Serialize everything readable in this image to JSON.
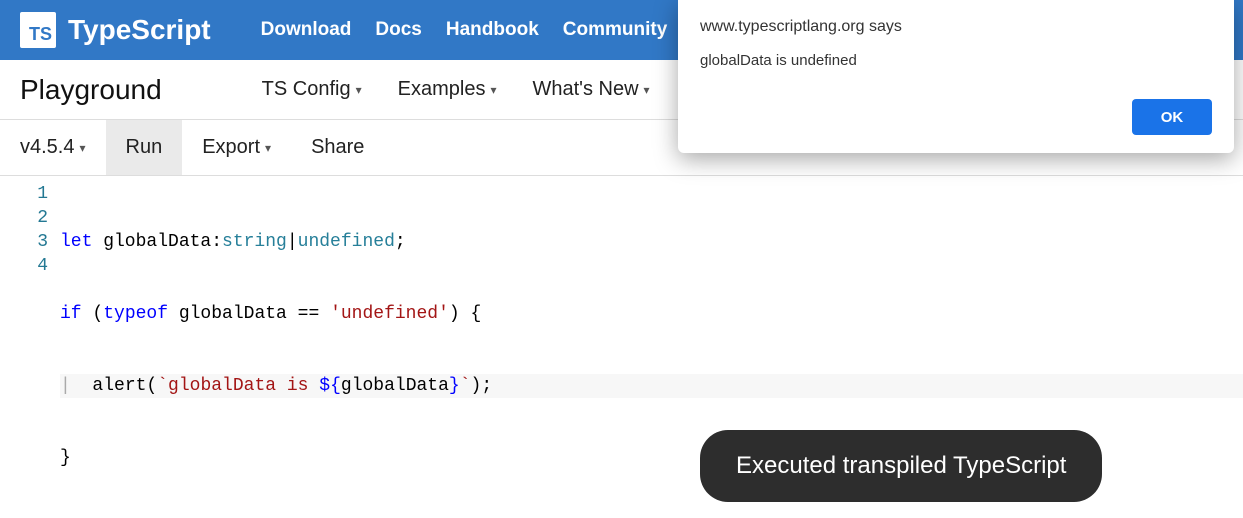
{
  "brand": {
    "logo_text": "TS",
    "name": "TypeScript"
  },
  "topnav": {
    "links": [
      "Download",
      "Docs",
      "Handbook",
      "Community"
    ]
  },
  "secondbar": {
    "title": "Playground",
    "items": [
      "TS Config",
      "Examples",
      "What's New"
    ]
  },
  "toolbar": {
    "version": "v4.5.4",
    "run": "Run",
    "export": "Export",
    "share": "Share"
  },
  "editor": {
    "gutter": [
      "1",
      "2",
      "3",
      "4"
    ],
    "code": {
      "l1": {
        "kw_let": "let",
        "ident": " globalData:",
        "type1": "string",
        "pipe": "|",
        "type2": "undefined",
        "tail": ";"
      },
      "l2": {
        "kw_if": "if",
        "p_open": " (",
        "kw_typeof": "typeof",
        "mid": " globalData == ",
        "str": "'undefined'",
        "tail": ") {"
      },
      "l3": {
        "indent": "  ",
        "fn": "alert(",
        "tmpl_open": "`",
        "tmpl_text": "globalData is ",
        "inter_open": "${",
        "inter_body": "globalData",
        "inter_close": "}",
        "tmpl_close": "`",
        "tail": ");"
      },
      "l4": {
        "text": "}"
      }
    }
  },
  "dialog": {
    "origin": "www.typescriptlang.org says",
    "message": "globalData is undefined",
    "ok": "OK"
  },
  "toast": {
    "text": "Executed transpiled TypeScript"
  }
}
